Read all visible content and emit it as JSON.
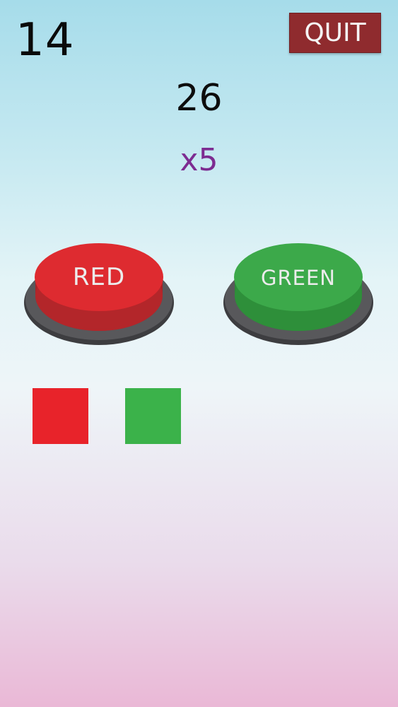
{
  "hud": {
    "timer": "14",
    "quit_label": "QUIT",
    "score": "26",
    "multiplier": "x5"
  },
  "buttons": {
    "red_label": "RED",
    "green_label": "GREEN"
  },
  "sequence": [
    {
      "color": "red",
      "hex": "#e8232a"
    },
    {
      "color": "green",
      "hex": "#3bb24a"
    }
  ],
  "colors": {
    "red_button_top": "#dc2a2e",
    "green_button_top": "#3aa748",
    "base_ring": "#4f4f52",
    "quit_bg": "#8f2b2e",
    "multiplier_text": "#7d2c91"
  }
}
